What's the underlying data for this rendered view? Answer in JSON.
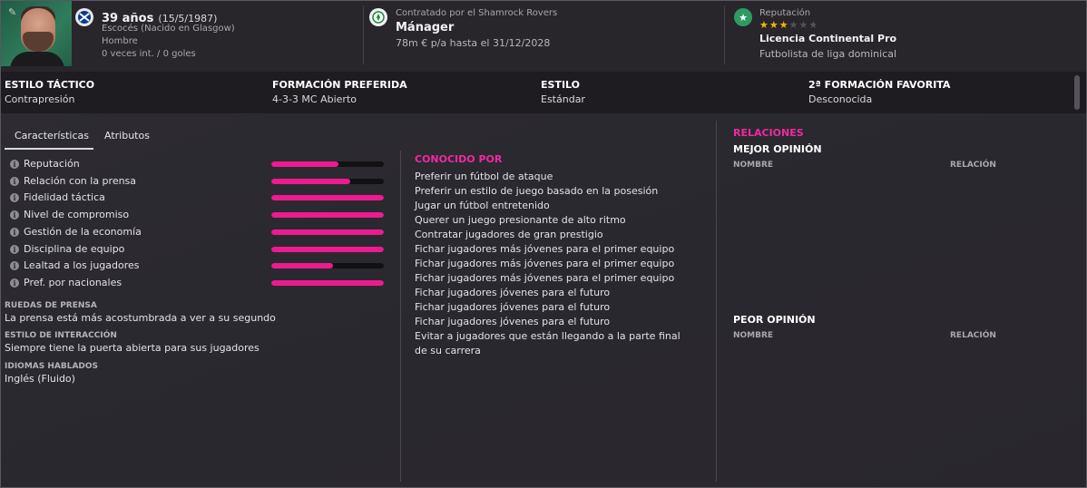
{
  "header": {
    "age": "39 años",
    "birthdate": "(15/5/1987)",
    "nationality": "Escocés (Nacido en Glasgow)",
    "gender": "Hombre",
    "caps": "0 veces int. / 0 goles",
    "contract_label": "Contratado por el Shamrock Rovers",
    "role": "Mánager",
    "salary": "78m € p/a hasta el 31/12/2028",
    "reputation_label": "Reputación",
    "reputation_stars": 3,
    "reputation_max": 6,
    "license": "Licencia Continental Pro",
    "reputation_level": "Futbolista de liga dominical"
  },
  "tactics": [
    {
      "label": "ESTILO TÁCTICO",
      "value": "Contrapresión"
    },
    {
      "label": "FORMACIÓN PREFERIDA",
      "value": "4-3-3 MC Abierto"
    },
    {
      "label": "ESTILO",
      "value": "Estándar"
    },
    {
      "label": "2ª FORMACIÓN FAVORITA",
      "value": "Desconocida"
    }
  ],
  "tabs": [
    "Características",
    "Atributos"
  ],
  "attributes": [
    {
      "label": "Reputación",
      "level": 0.6
    },
    {
      "label": "Relación con la prensa",
      "level": 0.7
    },
    {
      "label": "Fidelidad táctica",
      "level": 1.0
    },
    {
      "label": "Nivel de compromiso",
      "level": 1.0
    },
    {
      "label": "Gestión de la economía",
      "level": 1.0
    },
    {
      "label": "Disciplina de equipo",
      "level": 1.0
    },
    {
      "label": "Lealtad a los jugadores",
      "level": 0.55
    },
    {
      "label": "Pref. por nacionales",
      "level": 1.0
    }
  ],
  "details": {
    "press_label": "RUEDAS DE PRENSA",
    "press_value": "La prensa está más acostumbrada a ver a su segundo",
    "interaction_label": "ESTILO DE INTERACCIÓN",
    "interaction_value": "Siempre tiene la puerta abierta para sus jugadores",
    "languages_label": "IDIOMAS HABLADOS",
    "languages_value": "Inglés (Fluido)"
  },
  "known_for": {
    "title": "CONOCIDO POR",
    "items": [
      "Preferir un fútbol de ataque",
      "Preferir un estilo de juego basado en la posesión",
      "Jugar un fútbol entretenido",
      "Querer un juego presionante de alto ritmo",
      "Contratar jugadores de gran prestigio",
      "Fichar jugadores más jóvenes para el primer equipo",
      "Fichar jugadores más jóvenes para el primer equipo",
      "Fichar jugadores más jóvenes para el primer equipo",
      "Fichar jugadores jóvenes para el futuro",
      "Fichar jugadores jóvenes para el futuro",
      "Fichar jugadores jóvenes para el futuro",
      "Evitar a jugadores que están llegando a la parte final de su carrera"
    ]
  },
  "relations": {
    "title": "RELACIONES",
    "best_title": "MEJOR OPINIÓN",
    "worst_title": "PEOR OPINIÓN",
    "col_name": "NOMBRE",
    "col_relation": "RELACIÓN"
  },
  "colors": {
    "accent": "#ee1a90",
    "background": "#2b2930",
    "bar_bg": "#1e1c21",
    "star": "#f2b705"
  },
  "icons": {
    "edit": "pencil-icon",
    "nationality": "flag-icon",
    "club": "club-badge-icon",
    "reputation": "star-badge-icon",
    "info": "info-icon"
  }
}
